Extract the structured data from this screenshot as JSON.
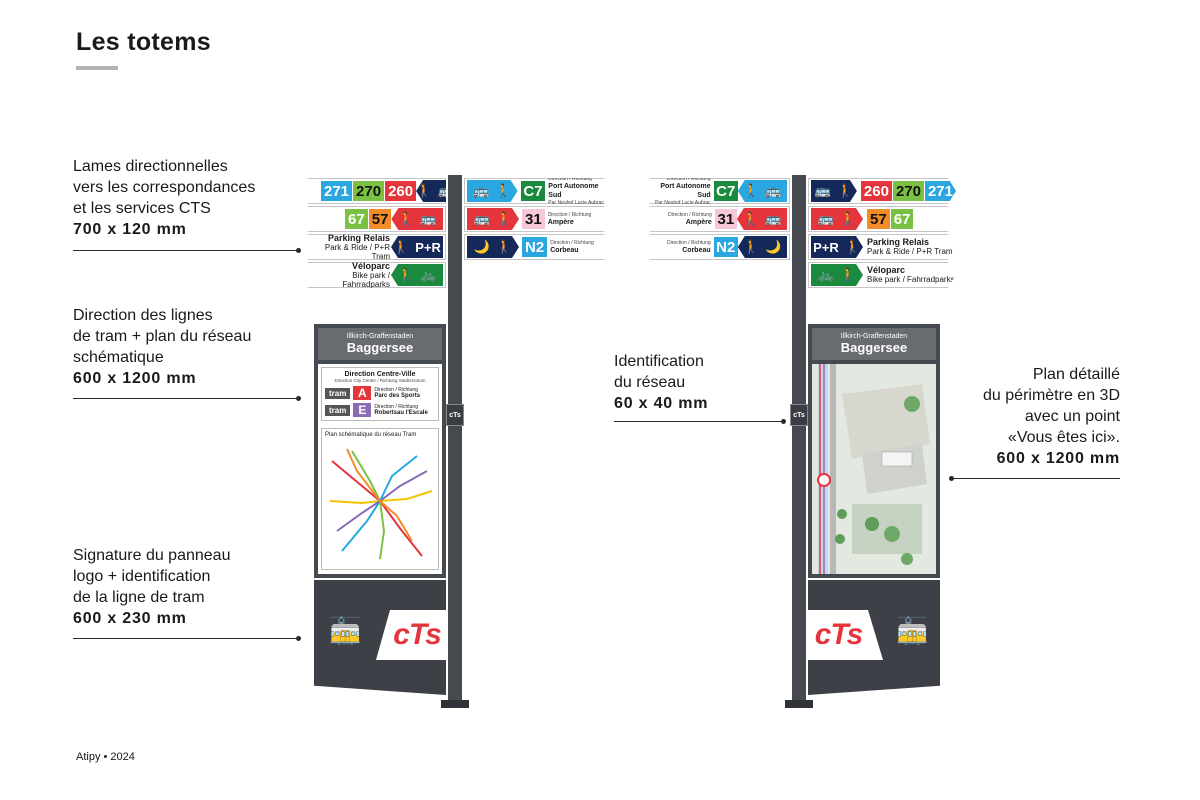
{
  "page": {
    "title": "Les totems",
    "footer": "Atipy • 2024"
  },
  "annotations": {
    "blades": {
      "lines": [
        "Lames directionnelles",
        "vers les correspondances",
        "et les services CTS"
      ],
      "dims": "700 x 120 mm"
    },
    "direction": {
      "lines": [
        "Direction des lignes",
        "de tram + plan du réseau",
        "schématique"
      ],
      "dims": "600 x 1200 mm"
    },
    "signature": {
      "lines": [
        "Signature du panneau",
        "logo + identification",
        "de la ligne de tram"
      ],
      "dims": "600 x 230 mm"
    },
    "identification": {
      "lines": [
        "Identification",
        "du réseau"
      ],
      "dims": "60 x 40 mm"
    },
    "plan": {
      "lines": [
        "Plan détaillé",
        "du périmètre en 3D",
        "avec un point",
        "«Vous êtes ici»."
      ],
      "dims": "600 x 1200 mm"
    }
  },
  "blades": {
    "bus_lines": [
      "271",
      "270",
      "260"
    ],
    "bus_lines_right": [
      "260",
      "270",
      "271"
    ],
    "lines_b": [
      "67",
      "57"
    ],
    "lines_b_right": [
      "57",
      "67"
    ],
    "parking": {
      "title": "Parking Relais",
      "sub": "Park & Ride / P+R Tram",
      "pict": "P+R"
    },
    "velo": {
      "title": "Véloparc",
      "sub": "Bike park / Fahrradparks"
    },
    "c7": {
      "line": "C7",
      "dir": "Direction / Richtung",
      "title": "Port Autonome Sud",
      "via": "Par Neuhof Lucie Aubrac"
    },
    "l31": {
      "line": "31",
      "dir": "Direction / Richtung",
      "title": "Ampère"
    },
    "n2": {
      "line": "N2",
      "dir": "Direction / Richtung",
      "title": "Corbeau"
    }
  },
  "panel": {
    "station_sub": "Illkirch-Graffenstaden",
    "station": "Baggersee",
    "direction_title": "Direction Centre-Ville",
    "direction_sub": "Direction City Center / Richtung Stadtzentrum",
    "tram_word": "tram",
    "tram_a": {
      "letter": "A",
      "dir": "Direction / Richtung",
      "dest": "Parc des Sports"
    },
    "tram_e": {
      "letter": "E",
      "dir": "Direction / Richtung",
      "dest": "Robertsau l'Escale"
    },
    "map_title": "Plan schématique du réseau Tram",
    "logo": "cTs",
    "pole_logo": "cTs"
  },
  "colors": {
    "tram_a": "#e5353c",
    "tram_e": "#8a6bb5",
    "panel": "#454950",
    "pole": "#464a50"
  },
  "icons": {
    "bus": "bus-icon",
    "walk": "pedestrian-icon",
    "tram": "tram-icon",
    "night": "night-bus-icon",
    "bike": "bicycle-icon"
  }
}
